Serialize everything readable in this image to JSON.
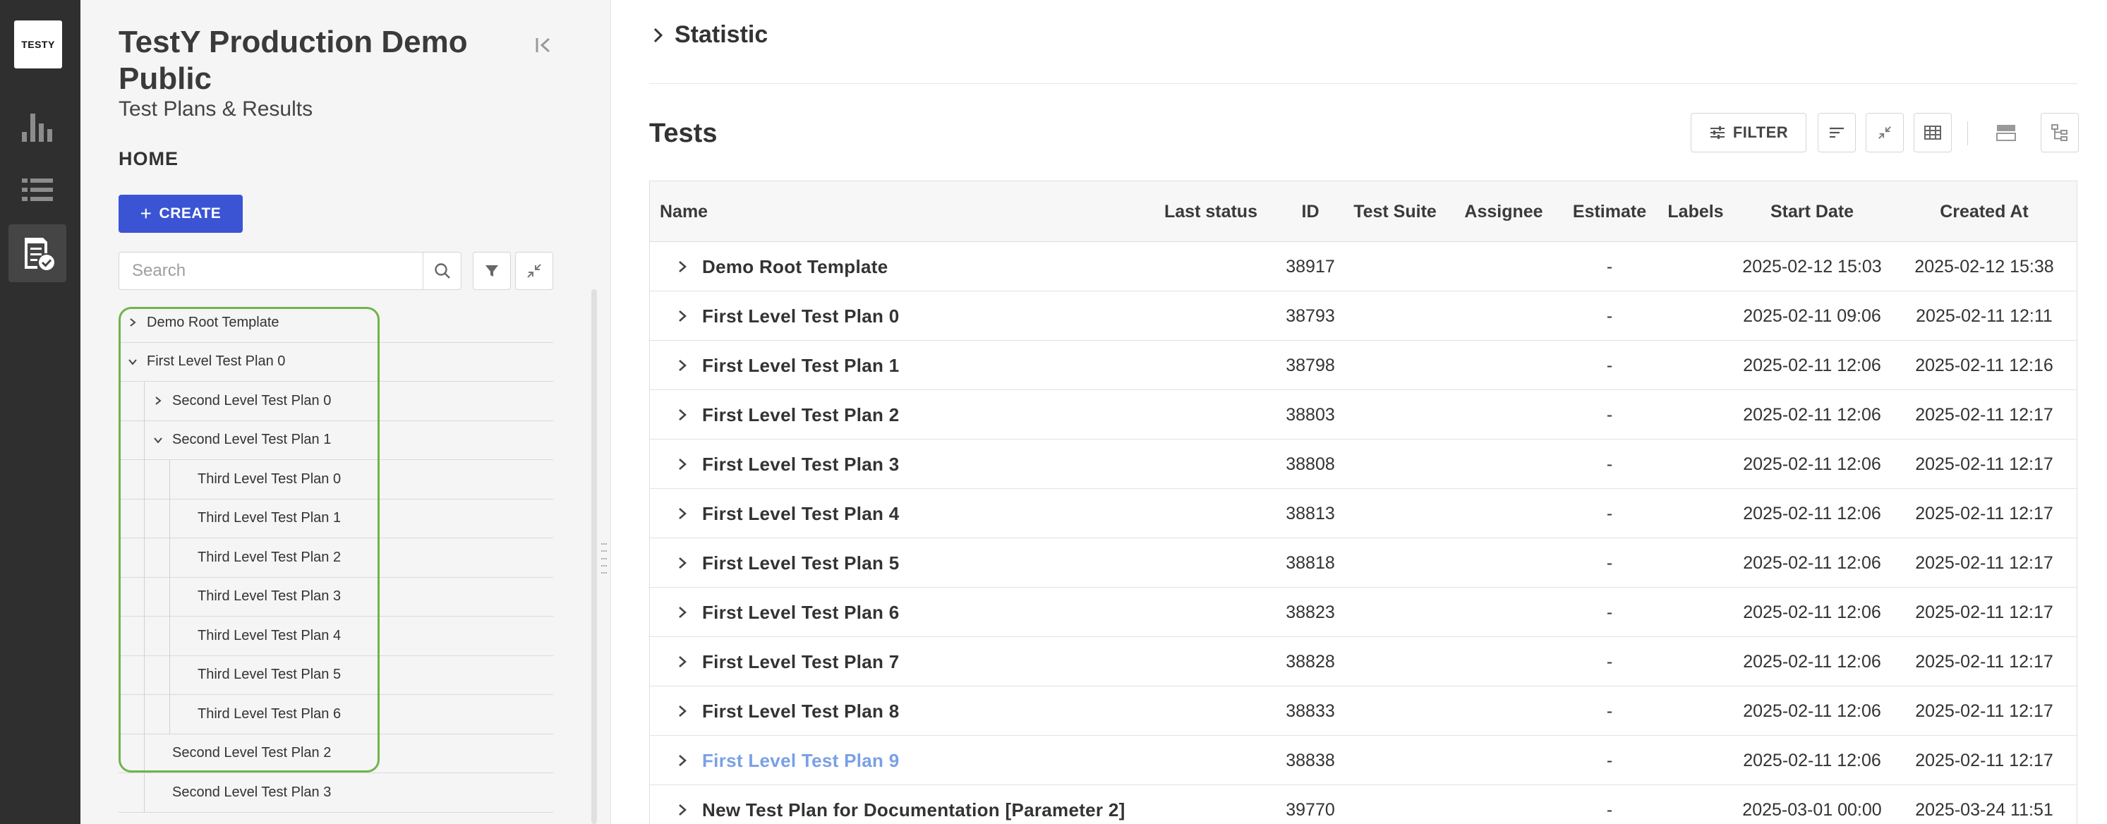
{
  "rail": {
    "logo_text": "TESTY",
    "items": [
      {
        "name": "statistics",
        "icon": "bar-chart-icon"
      },
      {
        "name": "list",
        "icon": "list-icon"
      },
      {
        "name": "test-plans",
        "icon": "test-plan-check-icon",
        "active": true
      }
    ]
  },
  "sidebar": {
    "project_title": "TestY Production Demo Public",
    "subtitle": "Test Plans & Results",
    "home_label": "HOME",
    "create_label": "CREATE",
    "search_placeholder": "Search",
    "tree": [
      {
        "label": "Demo Root Template",
        "level": 0,
        "chevron": "right"
      },
      {
        "label": "First Level Test Plan 0",
        "level": 0,
        "chevron": "down"
      },
      {
        "label": "Second Level Test Plan 0",
        "level": 1,
        "chevron": "right"
      },
      {
        "label": "Second Level Test Plan 1",
        "level": 1,
        "chevron": "down"
      },
      {
        "label": "Third Level Test Plan 0",
        "level": 2,
        "chevron": "none"
      },
      {
        "label": "Third Level Test Plan 1",
        "level": 2,
        "chevron": "none"
      },
      {
        "label": "Third Level Test Plan 2",
        "level": 2,
        "chevron": "none"
      },
      {
        "label": "Third Level Test Plan 3",
        "level": 2,
        "chevron": "none"
      },
      {
        "label": "Third Level Test Plan 4",
        "level": 2,
        "chevron": "none"
      },
      {
        "label": "Third Level Test Plan 5",
        "level": 2,
        "chevron": "none"
      },
      {
        "label": "Third Level Test Plan 6",
        "level": 2,
        "chevron": "none"
      },
      {
        "label": "Second Level Test Plan 2",
        "level": 1,
        "chevron": "none"
      },
      {
        "label": "Second Level Test Plan 3",
        "level": 1,
        "chevron": "none"
      }
    ],
    "highlight_color": "#6fb44c"
  },
  "main": {
    "statistic_label": "Statistic",
    "tests_title": "Tests",
    "filter_label": "FILTER",
    "columns": [
      "Name",
      "Last status",
      "ID",
      "Test Suite",
      "Assignee",
      "Estimate",
      "Labels",
      "Start Date",
      "Created At"
    ],
    "rows": [
      {
        "name": "Demo Root Template",
        "last_status": "",
        "id": "38917",
        "test_suite": "",
        "assignee": "",
        "estimate": "-",
        "labels": "",
        "start_date": "2025-02-12 15:03",
        "created_at": "2025-02-12 15:38"
      },
      {
        "name": "First Level Test Plan 0",
        "last_status": "",
        "id": "38793",
        "test_suite": "",
        "assignee": "",
        "estimate": "-",
        "labels": "",
        "start_date": "2025-02-11 09:06",
        "created_at": "2025-02-11 12:11"
      },
      {
        "name": "First Level Test Plan 1",
        "last_status": "",
        "id": "38798",
        "test_suite": "",
        "assignee": "",
        "estimate": "-",
        "labels": "",
        "start_date": "2025-02-11 12:06",
        "created_at": "2025-02-11 12:16"
      },
      {
        "name": "First Level Test Plan 2",
        "last_status": "",
        "id": "38803",
        "test_suite": "",
        "assignee": "",
        "estimate": "-",
        "labels": "",
        "start_date": "2025-02-11 12:06",
        "created_at": "2025-02-11 12:17"
      },
      {
        "name": "First Level Test Plan 3",
        "last_status": "",
        "id": "38808",
        "test_suite": "",
        "assignee": "",
        "estimate": "-",
        "labels": "",
        "start_date": "2025-02-11 12:06",
        "created_at": "2025-02-11 12:17"
      },
      {
        "name": "First Level Test Plan 4",
        "last_status": "",
        "id": "38813",
        "test_suite": "",
        "assignee": "",
        "estimate": "-",
        "labels": "",
        "start_date": "2025-02-11 12:06",
        "created_at": "2025-02-11 12:17"
      },
      {
        "name": "First Level Test Plan 5",
        "last_status": "",
        "id": "38818",
        "test_suite": "",
        "assignee": "",
        "estimate": "-",
        "labels": "",
        "start_date": "2025-02-11 12:06",
        "created_at": "2025-02-11 12:17"
      },
      {
        "name": "First Level Test Plan 6",
        "last_status": "",
        "id": "38823",
        "test_suite": "",
        "assignee": "",
        "estimate": "-",
        "labels": "",
        "start_date": "2025-02-11 12:06",
        "created_at": "2025-02-11 12:17"
      },
      {
        "name": "First Level Test Plan 7",
        "last_status": "",
        "id": "38828",
        "test_suite": "",
        "assignee": "",
        "estimate": "-",
        "labels": "",
        "start_date": "2025-02-11 12:06",
        "created_at": "2025-02-11 12:17"
      },
      {
        "name": "First Level Test Plan 8",
        "last_status": "",
        "id": "38833",
        "test_suite": "",
        "assignee": "",
        "estimate": "-",
        "labels": "",
        "start_date": "2025-02-11 12:06",
        "created_at": "2025-02-11 12:17"
      },
      {
        "name": "First Level Test Plan 9",
        "last_status": "",
        "id": "38838",
        "test_suite": "",
        "assignee": "",
        "estimate": "-",
        "labels": "",
        "start_date": "2025-02-11 12:06",
        "created_at": "2025-02-11 12:17",
        "hover": true
      },
      {
        "name": "New Test Plan for Documentation [Parameter 2]",
        "last_status": "",
        "id": "39770",
        "test_suite": "",
        "assignee": "",
        "estimate": "-",
        "labels": "",
        "start_date": "2025-03-01 00:00",
        "created_at": "2025-03-24 11:51"
      }
    ]
  },
  "colors": {
    "rail_bg": "#2f2f2f",
    "accent": "#3b54d4",
    "link_hover": "#7aa0e6"
  }
}
